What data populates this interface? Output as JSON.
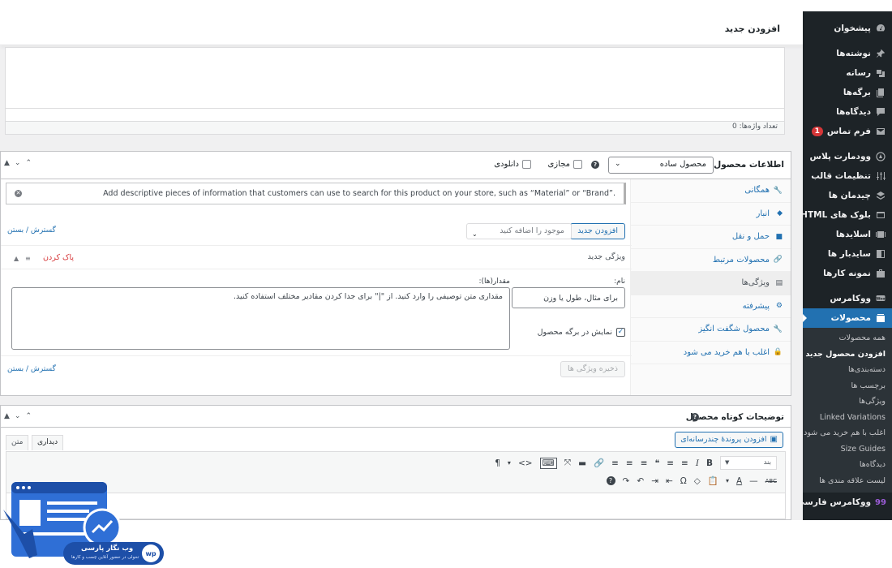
{
  "page": {
    "title": "افزودن جدید"
  },
  "sidebar": {
    "items": [
      {
        "label": "پیشخوان",
        "icon": "dashboard-icon"
      },
      {
        "label": "نوشته‌ها",
        "icon": "pin-icon"
      },
      {
        "label": "رسانه",
        "icon": "media-icon"
      },
      {
        "label": "برگه‌ها",
        "icon": "pages-icon"
      },
      {
        "label": "دیدگاه‌ها",
        "icon": "comments-icon"
      },
      {
        "label": "فرم تماس",
        "icon": "mail-icon",
        "badge": "1"
      },
      {
        "label": "وودمارت پلاس",
        "icon": "woodmart-icon"
      },
      {
        "label": "تنظیمات قالب",
        "icon": "sliders-icon"
      },
      {
        "label": "چیدمان ها",
        "icon": "layers-icon"
      },
      {
        "label": "بلوک های HTML",
        "icon": "html-block-icon"
      },
      {
        "label": "اسلایدها",
        "icon": "slides-icon"
      },
      {
        "label": "سایدبار ها",
        "icon": "sidebar-icon"
      },
      {
        "label": "نمونه کارها",
        "icon": "portfolio-icon"
      },
      {
        "label": "ووکامرس",
        "icon": "woocommerce-icon"
      },
      {
        "label": "محصولات",
        "icon": "products-icon"
      }
    ],
    "submenu": [
      "همه محصولات",
      "افزودن محصول جدید",
      "دسته‌بندی‌ها",
      "برچسب ها",
      "ویژگی‌ها",
      "Linked Variations",
      "اغلب با هم خرید می شود",
      "Size Guides",
      "دیدگاه‌ها",
      "لیست علاقه مندی ها"
    ],
    "bottom_item": {
      "label": "ووکامرس فارسی",
      "icon": "woocommerce-persian-icon"
    }
  },
  "editor": {
    "word_count": "تعداد واژه‌ها: 0"
  },
  "product_data": {
    "title": "اطلاعات محصول —",
    "type_selected": "محصول ساده",
    "virtual_label": "مجازی",
    "downloadable_label": "دانلودی",
    "tabs": [
      {
        "label": "همگانی",
        "icon": "wrench-icon"
      },
      {
        "label": "انبار",
        "icon": "tag-icon"
      },
      {
        "label": "حمل و نقل",
        "icon": "truck-icon"
      },
      {
        "label": "محصولات مرتبط",
        "icon": "link-icon"
      },
      {
        "label": "ویژگی‌ها",
        "icon": "table-icon"
      },
      {
        "label": "پیشرفته",
        "icon": "gear-icon"
      },
      {
        "label": "محصول شگفت انگیز",
        "icon": "wrench-icon"
      },
      {
        "label": "اغلب با هم خرید می شود",
        "icon": "lock-icon"
      }
    ],
    "notice": "Add descriptive pieces of information that customers can use to search for this product on your store, such as “Material” or “Brand”.",
    "add_new_button": "افزودن جدید",
    "existing_placeholder": "موجود را اضافه کنید",
    "expand_collapse": "گسترش / بستن",
    "new_attribute_title": "ویژگی جدید",
    "remove_label": "پاک کردن",
    "name_label": "نام:",
    "name_placeholder": "برای مثال، طول یا وزن",
    "values_label": "مقدار(ها):",
    "values_placeholder": "مقداری متن توصیفی را وارد کنید. از \"|\" برای جدا کردن مقادیر مختلف استفاده کنید.",
    "visible_label": "نمایش در برگه محصول",
    "save_attributes": "ذخیره ویژگی ها"
  },
  "short_description": {
    "title": "توضیحات کوتاه محصول",
    "add_media": "افزودن پروندهٔ چندرسانه‌ای",
    "tab_visual": "دیداری",
    "tab_text": "متن",
    "format_select": "بند",
    "toolbar_row1": [
      "B",
      "I",
      "≡",
      "≡",
      "❝",
      "≡",
      "≡",
      "≡",
      "🔗",
      "▬",
      "⤧",
      "⌨",
      "<>",
      "▾",
      "¶"
    ],
    "toolbar_row2": [
      "ABC",
      "—",
      "A",
      "▾",
      "📋",
      "◇",
      "Ω",
      "⇤",
      "⇥",
      "↶",
      "↷",
      "?"
    ]
  },
  "watermark": {
    "brand": "وب نگار پارسی",
    "tagline": "تحولی در حضور آنلاین چسب و کارها"
  },
  "colors": {
    "sidebar_bg": "#1d2327",
    "accent": "#2271b1",
    "danger": "#d63638"
  }
}
